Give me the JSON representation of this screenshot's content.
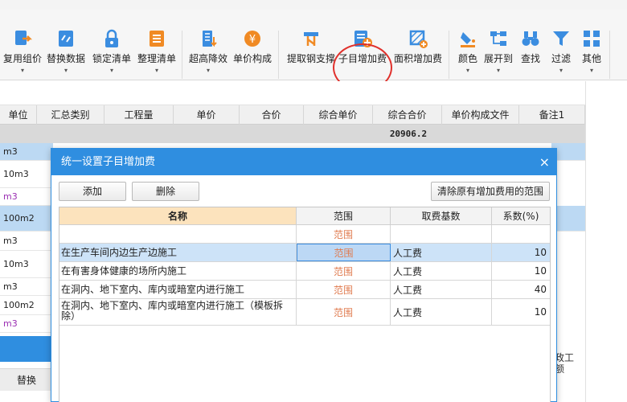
{
  "toolbar": {
    "items": [
      {
        "label": "复用组价",
        "icon": "reuse-pricing-icon",
        "caret": "▾"
      },
      {
        "label": "替换数据",
        "icon": "replace-data-icon",
        "caret": "▾"
      },
      {
        "label": "锁定清单",
        "icon": "lock-list-icon",
        "caret": "▾"
      },
      {
        "label": "整理清单",
        "icon": "organize-list-icon",
        "caret": "▾"
      },
      {
        "label": "超高降效",
        "icon": "high-rise-efficiency-icon",
        "caret": "▾"
      },
      {
        "label": "单价构成",
        "icon": "unit-price-composition-icon",
        "caret": ""
      },
      {
        "label": "提取钢支撑",
        "icon": "extract-steel-support-icon",
        "caret": ""
      },
      {
        "label": "子目增加费",
        "icon": "sub-item-surcharge-icon",
        "caret": ""
      },
      {
        "label": "面积增加费",
        "icon": "area-surcharge-icon",
        "caret": ""
      },
      {
        "label": "颜色",
        "icon": "color-icon",
        "caret": "▾"
      },
      {
        "label": "展开到",
        "icon": "expand-to-icon",
        "caret": "▾"
      },
      {
        "label": "查找",
        "icon": "find-icon",
        "caret": ""
      },
      {
        "label": "过滤",
        "icon": "filter-icon",
        "caret": "▾"
      },
      {
        "label": "其他",
        "icon": "other-icon",
        "caret": "▾"
      }
    ]
  },
  "grid": {
    "columns": [
      "单位",
      "汇总类别",
      "工程量",
      "单价",
      "合价",
      "综合单价",
      "综合合价",
      "单价构成文件",
      "备注1"
    ],
    "summary_value": "20906.2",
    "units": [
      "m3",
      "10m3",
      "m3",
      "100m2",
      "m3",
      "10m3",
      "m3",
      "100m2",
      "m3"
    ],
    "replace_label": "替换",
    "partial_right": "政工\n额"
  },
  "dialog": {
    "title": "统一设置子目增加费",
    "close_label": "×",
    "add_label": "添加",
    "delete_label": "删除",
    "clear_label": "清除原有增加费用的范围",
    "headers": {
      "name": "名称",
      "range": "范围",
      "base": "取费基数",
      "coef": "系数(%)"
    },
    "rows": [
      {
        "name": "",
        "range": "范围",
        "base": "",
        "coef": ""
      },
      {
        "name": "在生产车间内边生产边施工",
        "range": "范围",
        "base": "人工费",
        "coef": "10"
      },
      {
        "name": "在有害身体健康的场所内施工",
        "range": "范围",
        "base": "人工费",
        "coef": "10"
      },
      {
        "name": "在洞内、地下室内、库内或暗室内进行施工",
        "range": "范围",
        "base": "人工费",
        "coef": "40"
      },
      {
        "name": "在洞内、地下室内、库内或暗室内进行施工（模板拆除）",
        "range": "范围",
        "base": "人工费",
        "coef": "10"
      }
    ]
  }
}
